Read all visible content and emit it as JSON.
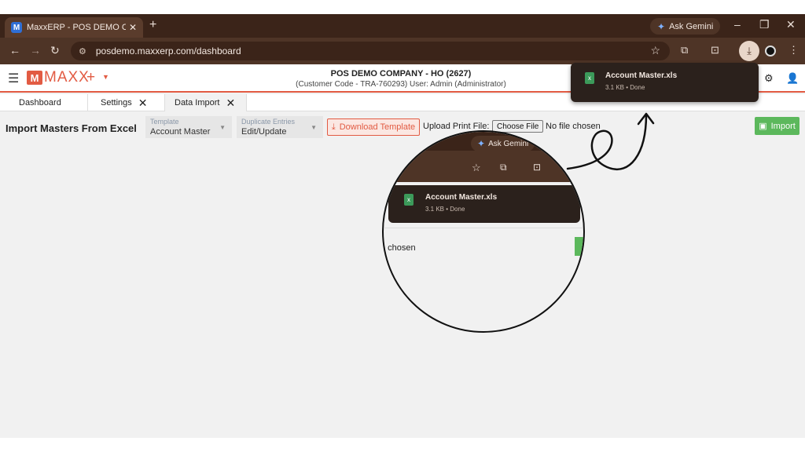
{
  "browser": {
    "tab_title": "MaxxERP - POS DEMO COMPA",
    "tab_favicon": "M",
    "new_tab": "+",
    "gemini_label": "Ask Gemini",
    "url": "posdemo.maxxerp.com/dashboard",
    "window_minimize": "–",
    "window_restore": "❐",
    "window_close": "✕"
  },
  "app": {
    "logo_mark": "M",
    "logo_word": "MAXX",
    "add_symbol": "+",
    "company_line1": "POS DEMO COMPANY - HO (2627)",
    "company_line2": "(Customer Code - TRA-760293) User: Admin (Administrator)"
  },
  "tabs": [
    {
      "label": "Dashboard"
    },
    {
      "label": "Settings"
    },
    {
      "label": "Data Import"
    }
  ],
  "page": {
    "title": "Import Masters From Excel",
    "template_label": "Template",
    "template_value": "Account Master",
    "duplicate_label": "Duplicate Entries",
    "duplicate_value": "Edit/Update",
    "download_template": "Download Template",
    "upload_label": "Upload Print File:",
    "choose_file": "Choose File",
    "no_file": "No file chosen",
    "import_label": "Import"
  },
  "download": {
    "file_name": "Account Master.xls",
    "file_meta": "3.1 KB • Done"
  },
  "magnifier": {
    "gemini_label": "Ask Gemini",
    "file_name": "Account Master.xls",
    "file_meta": "3.1 KB • Done",
    "partial_text": "e chosen"
  },
  "colors": {
    "accent": "#e25b43",
    "import_green": "#5cb85c",
    "chrome_dark": "#3b2419",
    "chrome_mid": "#4e3426"
  }
}
